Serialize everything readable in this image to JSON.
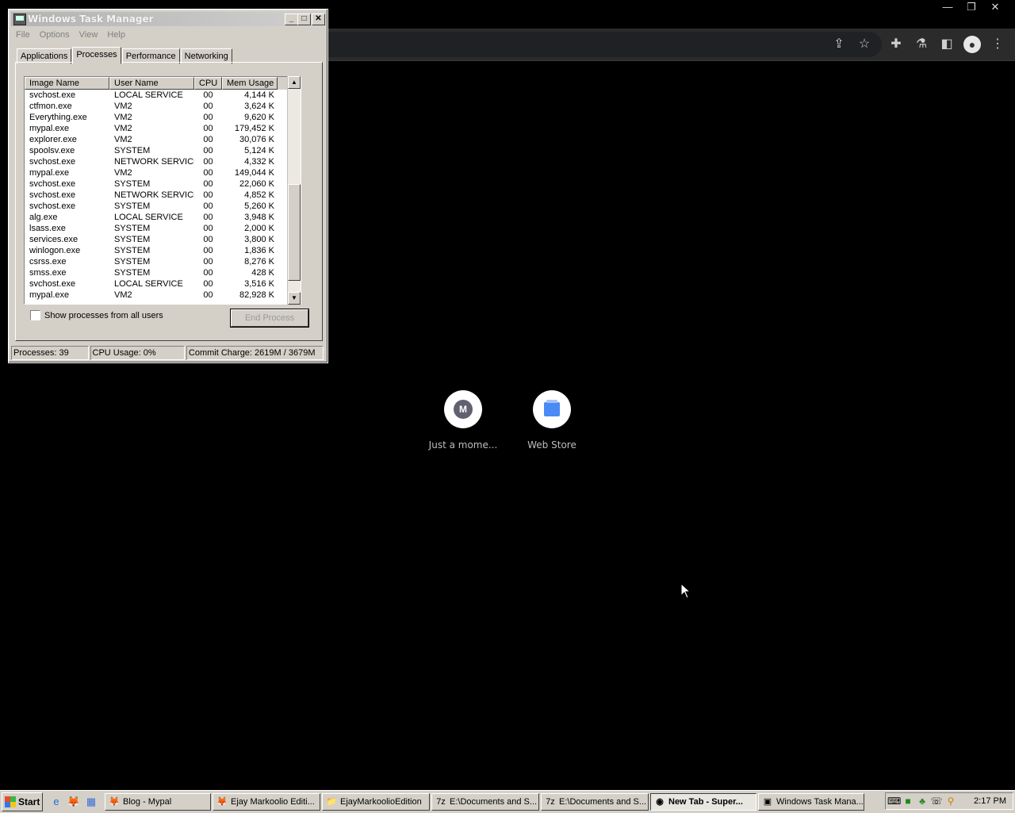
{
  "browser": {
    "window_controls": [
      "—",
      "❐",
      "✕"
    ],
    "toolbar_icons": [
      "share-icon",
      "star-icon",
      "extensions-icon",
      "labs-icon",
      "side-panel-icon",
      "profile-icon",
      "menu-icon"
    ],
    "shortcuts": [
      {
        "label": "Just a mome...",
        "favicon_letter": "M"
      },
      {
        "label": "Web Store"
      }
    ]
  },
  "task_manager": {
    "title": "Windows Task Manager",
    "menu": [
      "File",
      "Options",
      "View",
      "Help"
    ],
    "tabs": [
      "Applications",
      "Processes",
      "Performance",
      "Networking"
    ],
    "active_tab": "Processes",
    "columns": [
      "Image Name",
      "User Name",
      "CPU",
      "Mem Usage"
    ],
    "processes": [
      [
        "svchost.exe",
        "LOCAL SERVICE",
        "00",
        "4,144 K"
      ],
      [
        "ctfmon.exe",
        "VM2",
        "00",
        "3,624 K"
      ],
      [
        "Everything.exe",
        "VM2",
        "00",
        "9,620 K"
      ],
      [
        "mypal.exe",
        "VM2",
        "00",
        "179,452 K"
      ],
      [
        "explorer.exe",
        "VM2",
        "00",
        "30,076 K"
      ],
      [
        "spoolsv.exe",
        "SYSTEM",
        "00",
        "5,124 K"
      ],
      [
        "svchost.exe",
        "NETWORK SERVICE",
        "00",
        "4,332 K"
      ],
      [
        "mypal.exe",
        "VM2",
        "00",
        "149,044 K"
      ],
      [
        "svchost.exe",
        "SYSTEM",
        "00",
        "22,060 K"
      ],
      [
        "svchost.exe",
        "NETWORK SERVICE",
        "00",
        "4,852 K"
      ],
      [
        "svchost.exe",
        "SYSTEM",
        "00",
        "5,260 K"
      ],
      [
        "alg.exe",
        "LOCAL SERVICE",
        "00",
        "3,948 K"
      ],
      [
        "lsass.exe",
        "SYSTEM",
        "00",
        "2,000 K"
      ],
      [
        "services.exe",
        "SYSTEM",
        "00",
        "3,800 K"
      ],
      [
        "winlogon.exe",
        "SYSTEM",
        "00",
        "1,836 K"
      ],
      [
        "csrss.exe",
        "SYSTEM",
        "00",
        "8,276 K"
      ],
      [
        "smss.exe",
        "SYSTEM",
        "00",
        "428 K"
      ],
      [
        "svchost.exe",
        "LOCAL SERVICE",
        "00",
        "3,516 K"
      ],
      [
        "mypal.exe",
        "VM2",
        "00",
        "82,928 K"
      ]
    ],
    "show_all_label": "Show processes from all users",
    "show_all_checked": false,
    "end_process_label": "End Process",
    "status": {
      "processes": "Processes: 39",
      "cpu": "CPU Usage: 0%",
      "commit": "Commit Charge: 2619M / 3679M"
    }
  },
  "taskbar": {
    "start_label": "Start",
    "quick_launch": [
      "ie-icon",
      "firefox-icon",
      "desktop-icon"
    ],
    "tasks": [
      {
        "label": "Blog - Mypal",
        "icon": "🦊",
        "active": false
      },
      {
        "label": "Ejay Markoolio Editi...",
        "icon": "🦊",
        "active": false
      },
      {
        "label": "EjayMarkoolioEdition",
        "icon": "📁",
        "active": false
      },
      {
        "label": "E:\\Documents and S...",
        "icon": "7z",
        "active": false
      },
      {
        "label": "E:\\Documents and S...",
        "icon": "7z",
        "active": false
      },
      {
        "label": "New Tab - Super...",
        "icon": "◉",
        "active": true
      },
      {
        "label": "Windows Task Mana...",
        "icon": "▣",
        "active": false
      }
    ],
    "clock": "2:17 PM"
  }
}
